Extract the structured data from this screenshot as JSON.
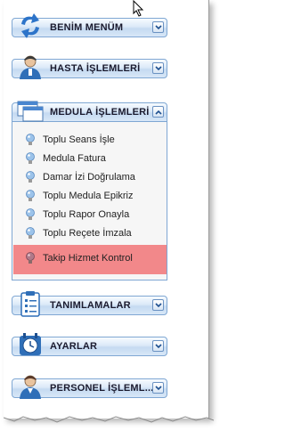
{
  "menu": [
    {
      "label": "BENİM MENÜM",
      "icon": "sync-arrows-icon"
    },
    {
      "label": "HASTA İŞLEMLERİ",
      "icon": "patient-icon"
    },
    {
      "label": "MEDULA İŞLEMLERİ",
      "icon": "windows-icon"
    },
    {
      "label": "TANIMLAMALAR",
      "icon": "clipboard-icon"
    },
    {
      "label": "AYARLAR",
      "icon": "clock-settings-icon"
    },
    {
      "label": "PERSONEL İŞLEML...",
      "icon": "staff-icon"
    }
  ],
  "medula_items": [
    {
      "label": "Toplu Seans İşle"
    },
    {
      "label": "Medula Fatura"
    },
    {
      "label": "Damar İzi Doğrulama"
    },
    {
      "label": "Toplu Medula Epikriz"
    },
    {
      "label": "Toplu Rapor Onayla"
    },
    {
      "label": "Toplu Reçete İmzala"
    },
    {
      "label": "Takip Hizmet Kontrol"
    }
  ],
  "colors": {
    "header_border": "#7fa7d3",
    "active_item": "#f2888a",
    "bulb_blue": "#9cc3ea"
  }
}
